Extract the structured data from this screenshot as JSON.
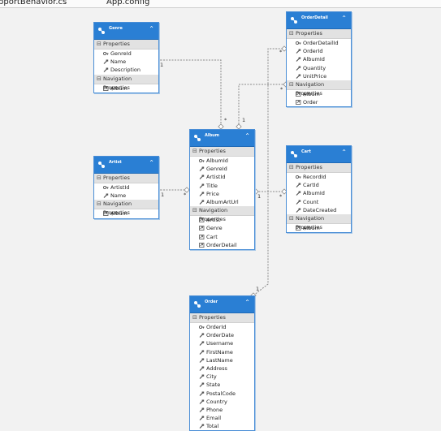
{
  "tabs": [
    "pportBehavior.cs",
    "App.config"
  ],
  "colors": {
    "header": "#2a7fd4",
    "border": "#4a8ed6",
    "connector": "#8a8a8a",
    "section_bg": "#e2e2e2"
  },
  "entities": [
    {
      "id": "genre",
      "name": "Genre",
      "sections": [
        {
          "label": "Properties",
          "items": [
            {
              "name": "GenreId",
              "key": true
            },
            {
              "name": "Name"
            },
            {
              "name": "Description"
            }
          ]
        },
        {
          "label": "Navigation Properties",
          "nav": true,
          "items": [
            {
              "name": "Album"
            }
          ]
        }
      ]
    },
    {
      "id": "orderdetail",
      "name": "OrderDetail",
      "sections": [
        {
          "label": "Properties",
          "items": [
            {
              "name": "OrderDetailId",
              "key": true
            },
            {
              "name": "OrderId"
            },
            {
              "name": "AlbumId"
            },
            {
              "name": "Quantity"
            },
            {
              "name": "UnitPrice"
            }
          ]
        },
        {
          "label": "Navigation Properties",
          "nav": true,
          "items": [
            {
              "name": "Album"
            },
            {
              "name": "Order"
            }
          ]
        }
      ]
    },
    {
      "id": "album",
      "name": "Album",
      "sections": [
        {
          "label": "Properties",
          "items": [
            {
              "name": "AlbumId",
              "key": true
            },
            {
              "name": "GenreId"
            },
            {
              "name": "ArtistId"
            },
            {
              "name": "Title"
            },
            {
              "name": "Price"
            },
            {
              "name": "AlbumArtUrl"
            }
          ]
        },
        {
          "label": "Navigation Properties",
          "nav": true,
          "items": [
            {
              "name": "Artist"
            },
            {
              "name": "Genre"
            },
            {
              "name": "Cart"
            },
            {
              "name": "OrderDetail"
            }
          ]
        }
      ]
    },
    {
      "id": "artist",
      "name": "Artist",
      "sections": [
        {
          "label": "Properties",
          "items": [
            {
              "name": "ArtistId",
              "key": true
            },
            {
              "name": "Name"
            }
          ]
        },
        {
          "label": "Navigation Properties",
          "nav": true,
          "items": [
            {
              "name": "Album"
            }
          ]
        }
      ]
    },
    {
      "id": "cart",
      "name": "Cart",
      "sections": [
        {
          "label": "Properties",
          "items": [
            {
              "name": "RecordId",
              "key": true
            },
            {
              "name": "CartId"
            },
            {
              "name": "AlbumId"
            },
            {
              "name": "Count"
            },
            {
              "name": "DateCreated"
            }
          ]
        },
        {
          "label": "Navigation Properties",
          "nav": true,
          "items": [
            {
              "name": "Album"
            }
          ]
        }
      ]
    },
    {
      "id": "order",
      "name": "Order",
      "sections": [
        {
          "label": "Properties",
          "items": [
            {
              "name": "OrderId",
              "key": true
            },
            {
              "name": "OrderDate"
            },
            {
              "name": "Username"
            },
            {
              "name": "FirstName"
            },
            {
              "name": "LastName"
            },
            {
              "name": "Address"
            },
            {
              "name": "City"
            },
            {
              "name": "State"
            },
            {
              "name": "PostalCode"
            },
            {
              "name": "Country"
            },
            {
              "name": "Phone"
            },
            {
              "name": "Email"
            },
            {
              "name": "Total"
            }
          ]
        }
      ]
    }
  ],
  "associations": [
    {
      "id": "genre-album",
      "end_a": "1",
      "end_b": "*"
    },
    {
      "id": "orderdetail-album",
      "end_a": "*",
      "end_b": "1"
    },
    {
      "id": "artist-album",
      "end_a": "1",
      "end_b": "*"
    },
    {
      "id": "album-cart",
      "end_a": "1",
      "end_b": "*"
    },
    {
      "id": "order-orderdetail",
      "end_a": "1",
      "end_b": "*"
    }
  ]
}
